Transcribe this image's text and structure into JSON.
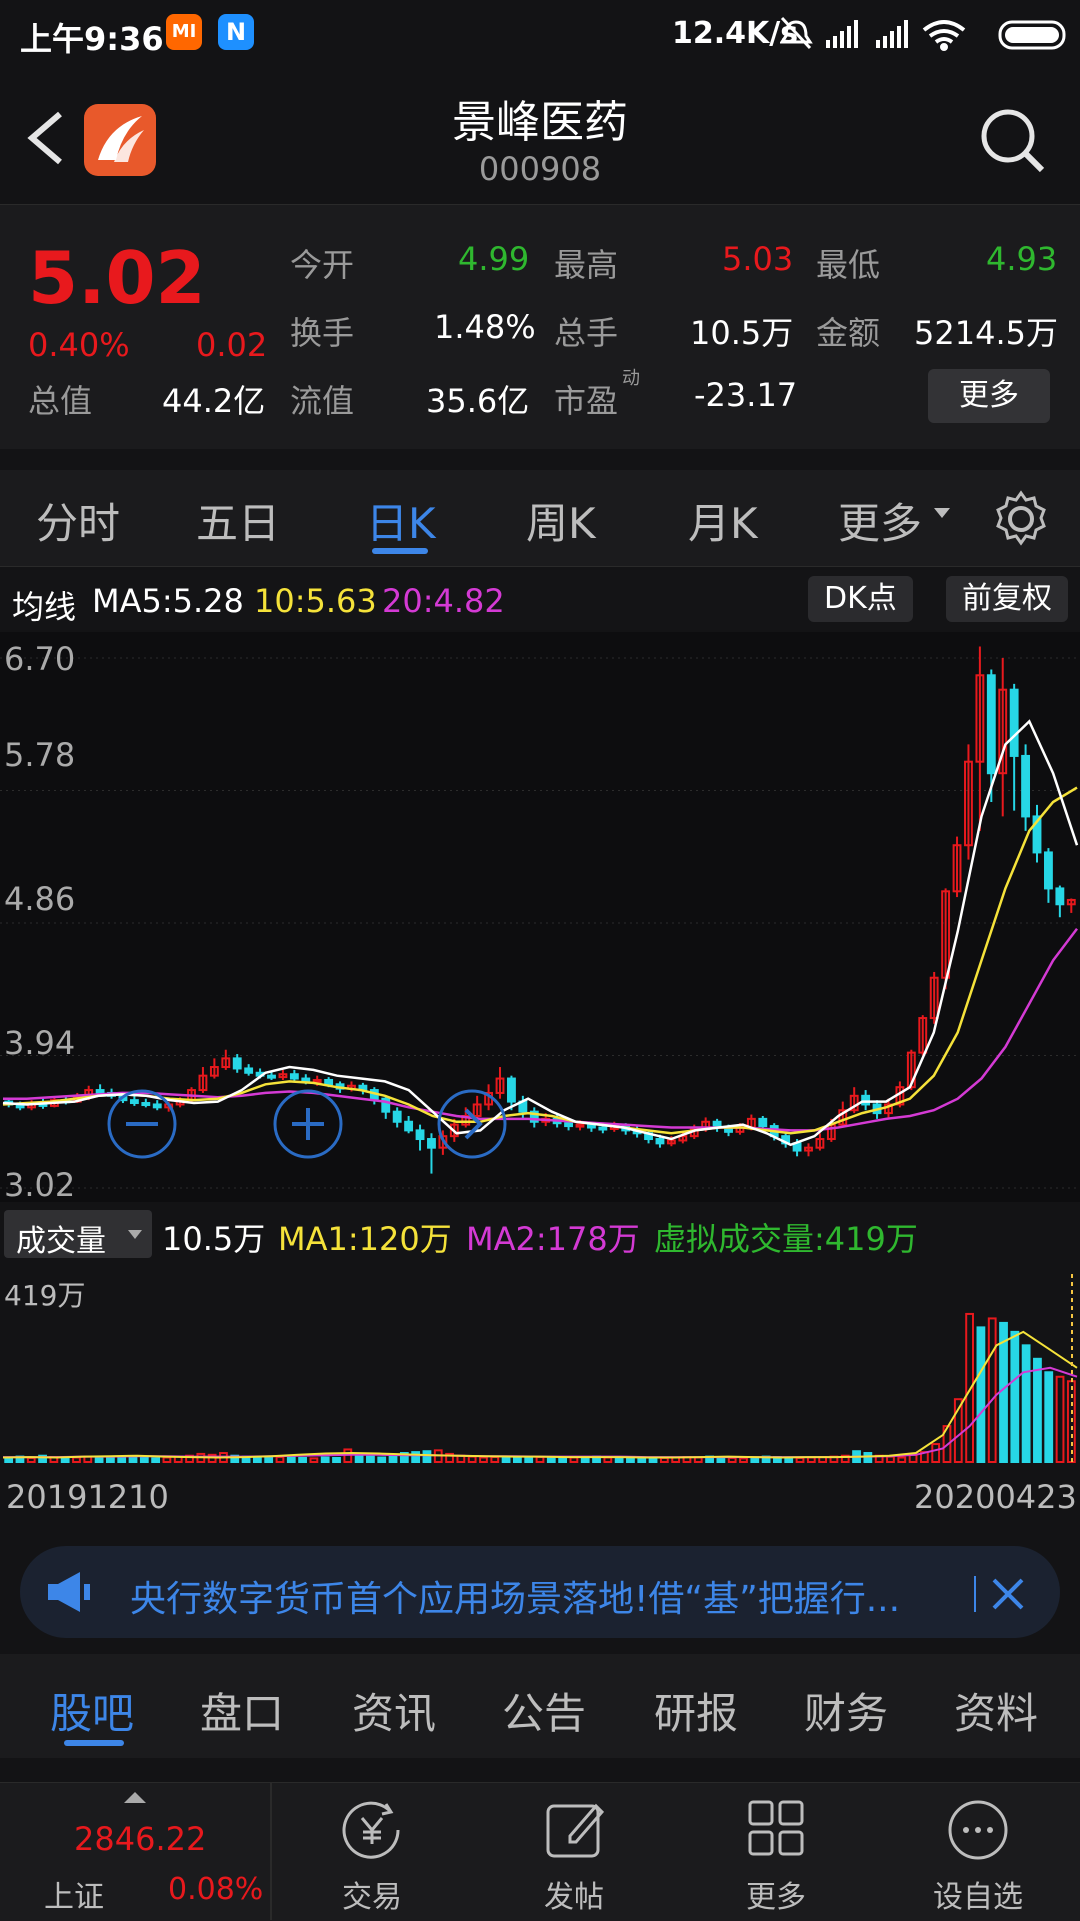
{
  "status_bar": {
    "time": "上午9:36",
    "mi_badge": "MI",
    "net_speed": "12.4K/s"
  },
  "header": {
    "title": "景峰医药",
    "code": "000908"
  },
  "quote": {
    "price": "5.02",
    "change_pct": "0.40%",
    "change": "0.02",
    "total_value_label": "总值",
    "total_value": "44.2亿",
    "open_label": "今开",
    "open": "4.99",
    "high_label": "最高",
    "high": "5.03",
    "low_label": "最低",
    "low": "4.93",
    "turnover_label": "换手",
    "turnover": "1.48%",
    "volume_label": "总手",
    "volume": "10.5万",
    "amount_label": "金额",
    "amount": "5214.5万",
    "float_label": "流值",
    "float": "35.6亿",
    "pe_label": "市盈",
    "pe_sup": "动",
    "pe": "-23.17",
    "more_label": "更多"
  },
  "chart_tabs": [
    {
      "label": "分时"
    },
    {
      "label": "五日"
    },
    {
      "label": "日K"
    },
    {
      "label": "周K"
    },
    {
      "label": "月K"
    },
    {
      "label": "更多"
    }
  ],
  "ma_legend": {
    "label": "均线",
    "ma5": "MA5:5.28",
    "ma10": "10:5.63",
    "ma20": "20:4.82",
    "dk_btn": "DK点",
    "fq_btn": "前复权"
  },
  "price_axis": [
    "6.70",
    "5.78",
    "4.86",
    "3.94",
    "3.02"
  ],
  "volume": {
    "selector": "成交量",
    "value": "10.5万",
    "ma1": "MA1:120万",
    "ma2": "MA2:178万",
    "virtual": "虚拟成交量:419万",
    "axis_max": "419万"
  },
  "dates": {
    "start": "20191210",
    "end": "20200423"
  },
  "announcement": {
    "text": "央行数字货币首个应用场景落地!借“基”把握行..."
  },
  "bottom_tabs": [
    {
      "label": "股吧"
    },
    {
      "label": "盘口"
    },
    {
      "label": "资讯"
    },
    {
      "label": "公告"
    },
    {
      "label": "研报"
    },
    {
      "label": "财务"
    },
    {
      "label": "资料"
    }
  ],
  "dock": {
    "index_value": "2846.22",
    "index_name": "上证",
    "index_pct": "0.08%",
    "items": [
      {
        "label": "交易"
      },
      {
        "label": "发帖"
      },
      {
        "label": "更多"
      },
      {
        "label": "设自选"
      }
    ]
  },
  "colors": {
    "up": "#e8191d",
    "down": "#2fb82f",
    "accent": "#3d86e8",
    "ma5": "#ffffff",
    "ma10": "#f5e23a",
    "ma20": "#d43ad4",
    "bear_candle": "#27d7e6"
  },
  "chart_data": {
    "type": "candlestick",
    "ylim": [
      3.02,
      6.7
    ],
    "y_ticks": [
      6.7,
      5.78,
      4.86,
      3.94,
      3.02
    ],
    "x_labels": [
      "20191210",
      "20200423"
    ],
    "ma": {
      "MA5": 5.28,
      "MA10": 5.63,
      "MA20": 4.82
    },
    "candles": [
      [
        3.62,
        3.6,
        3.64,
        3.58
      ],
      [
        3.6,
        3.58,
        3.62,
        3.56
      ],
      [
        3.58,
        3.61,
        3.63,
        3.56
      ],
      [
        3.61,
        3.59,
        3.64,
        3.57
      ],
      [
        3.59,
        3.63,
        3.65,
        3.58
      ],
      [
        3.63,
        3.62,
        3.66,
        3.6
      ],
      [
        3.62,
        3.65,
        3.68,
        3.61
      ],
      [
        3.65,
        3.7,
        3.73,
        3.63
      ],
      [
        3.7,
        3.68,
        3.74,
        3.66
      ],
      [
        3.68,
        3.66,
        3.71,
        3.64
      ],
      [
        3.66,
        3.63,
        3.68,
        3.61
      ],
      [
        3.63,
        3.61,
        3.66,
        3.59
      ],
      [
        3.61,
        3.6,
        3.64,
        3.58
      ],
      [
        3.6,
        3.58,
        3.63,
        3.56
      ],
      [
        3.58,
        3.6,
        3.62,
        3.55
      ],
      [
        3.6,
        3.63,
        3.65,
        3.58
      ],
      [
        3.63,
        3.7,
        3.72,
        3.61
      ],
      [
        3.7,
        3.8,
        3.86,
        3.68
      ],
      [
        3.8,
        3.86,
        3.92,
        3.78
      ],
      [
        3.86,
        3.92,
        3.98,
        3.84
      ],
      [
        3.92,
        3.85,
        3.95,
        3.82
      ],
      [
        3.85,
        3.82,
        3.88,
        3.8
      ],
      [
        3.82,
        3.8,
        3.85,
        3.78
      ],
      [
        3.8,
        3.79,
        3.83,
        3.77
      ],
      [
        3.79,
        3.81,
        3.84,
        3.77
      ],
      [
        3.81,
        3.78,
        3.84,
        3.76
      ],
      [
        3.78,
        3.76,
        3.81,
        3.74
      ],
      [
        3.76,
        3.77,
        3.8,
        3.73
      ],
      [
        3.77,
        3.74,
        3.79,
        3.72
      ],
      [
        3.74,
        3.71,
        3.76,
        3.68
      ],
      [
        3.71,
        3.73,
        3.76,
        3.69
      ],
      [
        3.73,
        3.7,
        3.75,
        3.67
      ],
      [
        3.7,
        3.64,
        3.72,
        3.6
      ],
      [
        3.64,
        3.55,
        3.66,
        3.5
      ],
      [
        3.55,
        3.48,
        3.58,
        3.44
      ],
      [
        3.48,
        3.42,
        3.52,
        3.4
      ],
      [
        3.42,
        3.36,
        3.46,
        3.28
      ],
      [
        3.36,
        3.3,
        3.4,
        3.12
      ],
      [
        3.3,
        3.38,
        3.42,
        3.25
      ],
      [
        3.38,
        3.46,
        3.5,
        3.34
      ],
      [
        3.46,
        3.52,
        3.58,
        3.44
      ],
      [
        3.52,
        3.6,
        3.66,
        3.48
      ],
      [
        3.6,
        3.68,
        3.74,
        3.56
      ],
      [
        3.68,
        3.78,
        3.86,
        3.64
      ],
      [
        3.78,
        3.62,
        3.8,
        3.56
      ],
      [
        3.62,
        3.55,
        3.66,
        3.5
      ],
      [
        3.55,
        3.48,
        3.58,
        3.44
      ],
      [
        3.48,
        3.5,
        3.54,
        3.45
      ],
      [
        3.5,
        3.47,
        3.53,
        3.44
      ],
      [
        3.47,
        3.45,
        3.5,
        3.42
      ],
      [
        3.45,
        3.46,
        3.49,
        3.42
      ],
      [
        3.46,
        3.44,
        3.48,
        3.41
      ],
      [
        3.44,
        3.43,
        3.47,
        3.4
      ],
      [
        3.43,
        3.45,
        3.48,
        3.41
      ],
      [
        3.45,
        3.42,
        3.47,
        3.39
      ],
      [
        3.42,
        3.4,
        3.45,
        3.37
      ],
      [
        3.4,
        3.36,
        3.42,
        3.33
      ],
      [
        3.36,
        3.33,
        3.39,
        3.3
      ],
      [
        3.33,
        3.35,
        3.38,
        3.31
      ],
      [
        3.35,
        3.38,
        3.41,
        3.33
      ],
      [
        3.38,
        3.43,
        3.46,
        3.36
      ],
      [
        3.43,
        3.48,
        3.51,
        3.41
      ],
      [
        3.48,
        3.44,
        3.5,
        3.41
      ],
      [
        3.44,
        3.41,
        3.46,
        3.38
      ],
      [
        3.41,
        3.44,
        3.47,
        3.39
      ],
      [
        3.44,
        3.5,
        3.53,
        3.42
      ],
      [
        3.5,
        3.45,
        3.52,
        3.43
      ],
      [
        3.45,
        3.38,
        3.47,
        3.35
      ],
      [
        3.38,
        3.33,
        3.4,
        3.3
      ],
      [
        3.33,
        3.28,
        3.36,
        3.24
      ],
      [
        3.28,
        3.3,
        3.33,
        3.24
      ],
      [
        3.3,
        3.36,
        3.4,
        3.28
      ],
      [
        3.36,
        3.46,
        3.5,
        3.34
      ],
      [
        3.46,
        3.56,
        3.62,
        3.44
      ],
      [
        3.56,
        3.66,
        3.72,
        3.54
      ],
      [
        3.66,
        3.6,
        3.7,
        3.56
      ],
      [
        3.6,
        3.54,
        3.63,
        3.5
      ],
      [
        3.54,
        3.6,
        3.64,
        3.51
      ],
      [
        3.6,
        3.72,
        3.76,
        3.58
      ],
      [
        3.72,
        3.96,
        3.98,
        3.7
      ],
      [
        3.96,
        4.2,
        4.22,
        3.94
      ],
      [
        4.2,
        4.48,
        4.52,
        4.16
      ],
      [
        4.48,
        5.08,
        5.1,
        4.4
      ],
      [
        5.08,
        5.4,
        5.46,
        5.04
      ],
      [
        5.4,
        5.98,
        6.1,
        5.3
      ],
      [
        5.98,
        6.58,
        6.78,
        5.5
      ],
      [
        6.58,
        5.9,
        6.62,
        5.7
      ],
      [
        5.9,
        6.48,
        6.7,
        5.6
      ],
      [
        6.48,
        6.02,
        6.52,
        5.64
      ],
      [
        6.02,
        5.6,
        6.1,
        5.5
      ],
      [
        5.6,
        5.35,
        5.68,
        5.28
      ],
      [
        5.35,
        5.1,
        5.38,
        5.0
      ],
      [
        5.1,
        4.99,
        5.12,
        4.9
      ],
      [
        4.99,
        5.02,
        5.03,
        4.93
      ]
    ],
    "ma5_line": [
      3.61,
      3.6,
      3.61,
      3.62,
      3.66,
      3.67,
      3.66,
      3.63,
      3.61,
      3.62,
      3.7,
      3.82,
      3.86,
      3.84,
      3.8,
      3.78,
      3.76,
      3.7,
      3.55,
      3.4,
      3.42,
      3.56,
      3.64,
      3.55,
      3.48,
      3.46,
      3.44,
      3.4,
      3.36,
      3.42,
      3.44,
      3.46,
      3.4,
      3.32,
      3.38,
      3.52,
      3.62,
      3.62,
      3.72,
      4.1,
      4.8,
      5.6,
      6.1,
      6.26,
      5.9,
      5.4
    ],
    "ma10_line": [
      3.6,
      3.61,
      3.62,
      3.64,
      3.66,
      3.67,
      3.66,
      3.64,
      3.63,
      3.64,
      3.68,
      3.74,
      3.76,
      3.75,
      3.72,
      3.7,
      3.66,
      3.6,
      3.52,
      3.48,
      3.48,
      3.52,
      3.54,
      3.52,
      3.48,
      3.46,
      3.44,
      3.42,
      3.4,
      3.42,
      3.44,
      3.44,
      3.42,
      3.4,
      3.42,
      3.48,
      3.54,
      3.58,
      3.64,
      3.8,
      4.1,
      4.6,
      5.1,
      5.5,
      5.7,
      5.8
    ],
    "ma20_line": [
      3.64,
      3.64,
      3.65,
      3.66,
      3.67,
      3.68,
      3.68,
      3.67,
      3.66,
      3.65,
      3.66,
      3.68,
      3.69,
      3.68,
      3.66,
      3.64,
      3.62,
      3.58,
      3.55,
      3.52,
      3.5,
      3.5,
      3.5,
      3.49,
      3.48,
      3.47,
      3.46,
      3.45,
      3.44,
      3.44,
      3.44,
      3.44,
      3.43,
      3.42,
      3.42,
      3.44,
      3.47,
      3.5,
      3.52,
      3.56,
      3.64,
      3.78,
      4.0,
      4.3,
      4.6,
      4.82
    ],
    "volumes": [
      10,
      12,
      9,
      14,
      11,
      8,
      10,
      12,
      9,
      10,
      11,
      10,
      9,
      8,
      10,
      12,
      14,
      18,
      16,
      20,
      14,
      12,
      10,
      9,
      11,
      10,
      9,
      8,
      10,
      9,
      28,
      15,
      12,
      10,
      16,
      20,
      22,
      24,
      26,
      18,
      14,
      12,
      10,
      11,
      9,
      10,
      12,
      11,
      10,
      9,
      10,
      11,
      12,
      10,
      9,
      11,
      10,
      8,
      9,
      10,
      11,
      10,
      12,
      10,
      9,
      8,
      10,
      12,
      11,
      10,
      9,
      10,
      11,
      12,
      14,
      24,
      20,
      14,
      12,
      10,
      16,
      22,
      40,
      80,
      140,
      330,
      300,
      320,
      310,
      290,
      260,
      230,
      200,
      190,
      180
    ],
    "vol_ma1_line": [
      10,
      11,
      10,
      12,
      13,
      14,
      12,
      11,
      10,
      11,
      13,
      16,
      19,
      20,
      19,
      17,
      15,
      14,
      13,
      12,
      12,
      11,
      11,
      11,
      10,
      10,
      11,
      12,
      11,
      10,
      11,
      11,
      12,
      14,
      20,
      60,
      160,
      260,
      290,
      250,
      210
    ],
    "vol_ma2_line": [
      11,
      11,
      11,
      12,
      12,
      13,
      13,
      12,
      12,
      12,
      13,
      14,
      15,
      16,
      16,
      15,
      15,
      14,
      13,
      13,
      12,
      12,
      12,
      12,
      11,
      11,
      11,
      11,
      11,
      11,
      11,
      11,
      12,
      13,
      16,
      30,
      80,
      150,
      200,
      210,
      190
    ]
  }
}
